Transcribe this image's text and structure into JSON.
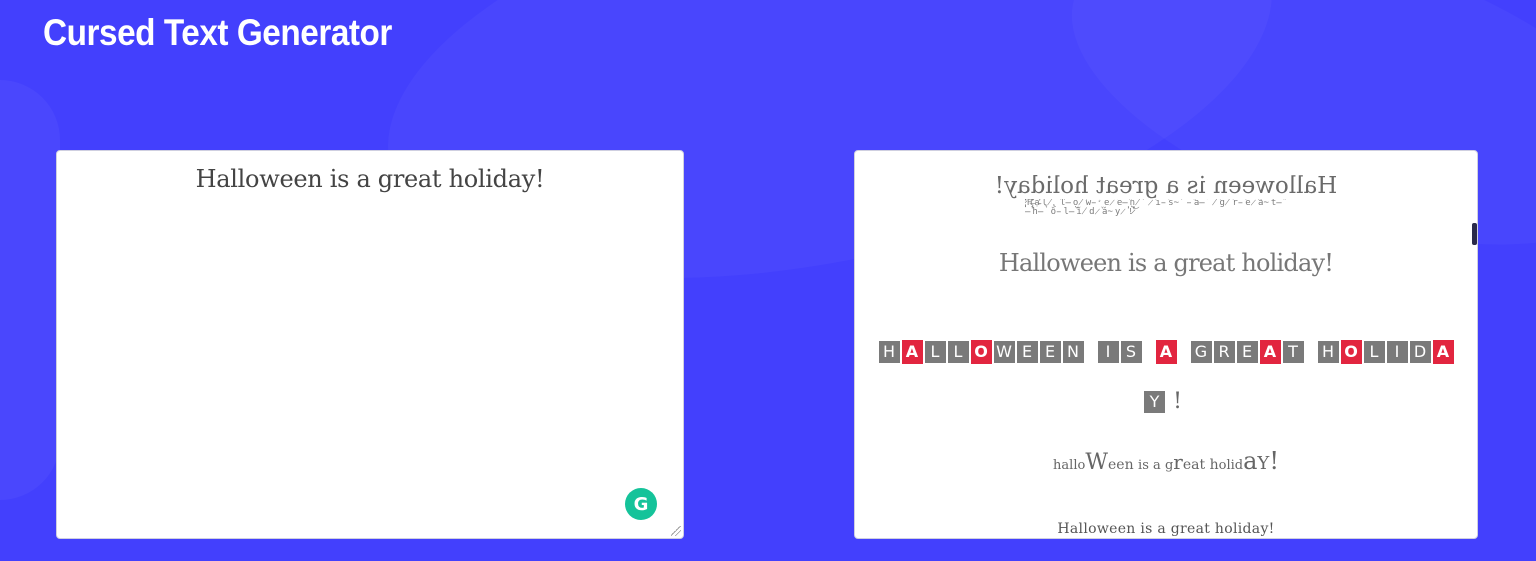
{
  "header": {
    "title": "Cursed Text Generator"
  },
  "input": {
    "value": "Halloween is a great holiday!"
  },
  "output": {
    "mirrored": "Halloween is a great holiday!",
    "zalgo": "Halloween is a great holiday!",
    "boxed_letters": [
      "H",
      "A",
      "L",
      "L",
      "O",
      "W",
      "E",
      "E",
      "N",
      " ",
      "I",
      "S",
      " ",
      "A",
      " ",
      "G",
      "R",
      "E",
      "A",
      "T",
      " ",
      "H",
      "O",
      "L",
      "I",
      "D",
      "A",
      "Y",
      "!"
    ],
    "waves": "halloWeen is a great holidaY!",
    "plain": "Halloween is a great holiday!"
  },
  "colors": {
    "background": "#4340fd",
    "accent_red": "#e2253f",
    "box_gray": "#7a7a7a",
    "grammarly_green": "#15c39a"
  }
}
